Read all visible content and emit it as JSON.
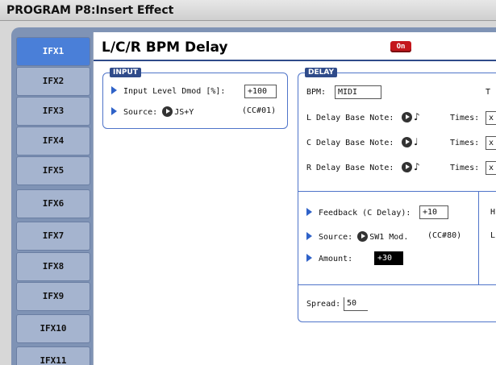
{
  "window": {
    "title": "PROGRAM P8:Insert Effect"
  },
  "tabs": [
    {
      "label": "IFX1",
      "active": true
    },
    {
      "label": "IFX2"
    },
    {
      "label": "IFX3"
    },
    {
      "label": "IFX4"
    },
    {
      "label": "IFX5"
    },
    {
      "label": "IFX6"
    },
    {
      "label": "IFX7"
    },
    {
      "label": "IFX8"
    },
    {
      "label": "IFX9"
    },
    {
      "label": "IFX10"
    },
    {
      "label": "IFX11"
    }
  ],
  "effect": {
    "name": "L/C/R BPM Delay",
    "on_label": "On",
    "on_color": "#c4161c"
  },
  "input": {
    "label": "INPUT",
    "level_dmod_label": "Input Level Dmod [%]:",
    "level_dmod_value": "+100",
    "source_label": "Source:",
    "source_value": "JS+Y",
    "source_cc": "(CC#01)"
  },
  "delay": {
    "label": "DELAY",
    "bpm_label": "BPM:",
    "bpm_value": "MIDI",
    "bpm_right_cut": "T",
    "l_note_label": "L Delay Base Note:",
    "l_note_glyph": "♪",
    "c_note_label": "C Delay Base Note:",
    "c_note_glyph": "♩",
    "r_note_label": "R Delay Base Note:",
    "r_note_glyph": "♪",
    "times_label": "Times:",
    "times_cut": "x"
  },
  "feedback": {
    "label": "Feedback (C Delay):",
    "value": "+10",
    "source_label": "Source:",
    "source_value": "SW1 Mod.",
    "source_cc": "(CC#80)",
    "amount_label": "Amount:",
    "amount_value": "+30",
    "right_cut_1": "H",
    "right_cut_2": "L"
  },
  "spread": {
    "label": "Spread:",
    "value": "50"
  }
}
